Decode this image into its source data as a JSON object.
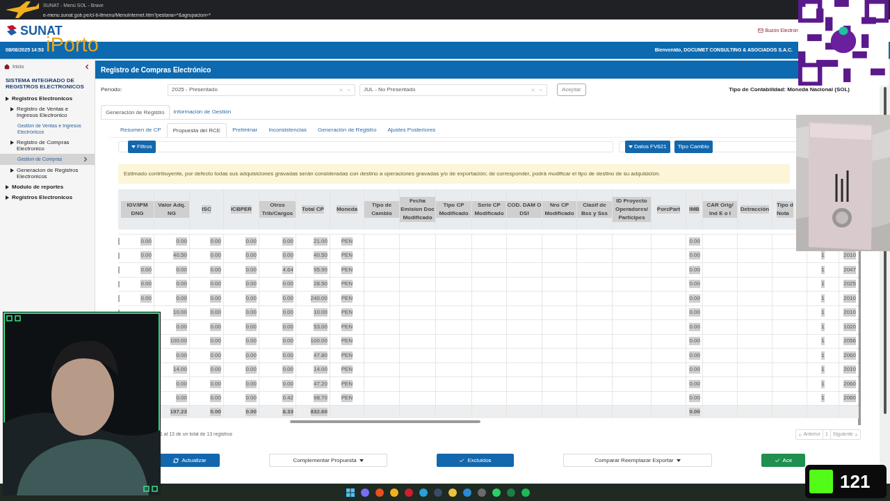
{
  "browser": {
    "title": "SUNAT - Menú SOL - Brave",
    "url": "e-menu.sunat.gob.pe/cl-ti-itmenu/MenuInternet.htm?pestana=*&agrupacion=*"
  },
  "header": {
    "logo": "SUNAT",
    "mailbox": "Buzón Electrón",
    "datetime": "08/08/2025 14:53",
    "welcome": "Bienvenido, DOCUMET CONSULTING & ASOCIADOS S.A.C."
  },
  "sidebar": {
    "home": "Inicio",
    "title": "SISTEMA INTEGRADO DE REGISTROS ELECTRONICOS",
    "items": [
      {
        "label": "Registros Electronicos",
        "kind": "folder",
        "selected": false,
        "children": [
          {
            "label": "Registro de Ventas e Ingresos Electronico",
            "kind": "folder",
            "selected": false,
            "children": [
              {
                "label": "Gestión de Ventas e Ingresos Electrónicos",
                "kind": "link",
                "selected": false
              }
            ]
          },
          {
            "label": "Registro de Compras Electronico",
            "kind": "folder",
            "selected": false,
            "children": [
              {
                "label": "Gestion de Compras",
                "kind": "link",
                "selected": true
              }
            ]
          },
          {
            "label": "Generacion de Registros Electronicos",
            "kind": "folder",
            "selected": false
          }
        ]
      },
      {
        "label": "Modulo de reportes",
        "kind": "folder",
        "selected": false
      },
      {
        "label": "Registros Electronicos",
        "kind": "folder",
        "selected": false
      }
    ]
  },
  "main": {
    "title": "Registro de Compras Electrónico",
    "period_label": "Período:",
    "year_select": "2025 - Presentado",
    "month_select": "JUL - No Presentado",
    "accept_button": "Aceptar",
    "accounting_type": "Tipo de Contabilidad: Moneda Nacional (SOL)",
    "tabs": [
      {
        "label": "Generación de Registro",
        "selected": true
      },
      {
        "label": "Información de Gestión",
        "selected": false
      }
    ],
    "subtabs": [
      {
        "label": "Resumen de CP",
        "selected": false
      },
      {
        "label": "Propuesta del RCE",
        "selected": true
      },
      {
        "label": "Preliminar",
        "selected": false
      },
      {
        "label": "Inconsistencias",
        "selected": false
      },
      {
        "label": "Generación de Registro",
        "selected": false
      },
      {
        "label": "Ajustes Posteriores",
        "selected": false
      }
    ],
    "filter_button": "Filtros",
    "fv621_button": "Datos FV621",
    "exchange_button": "Tipo Cambio",
    "notice": "Estimado contribuyente, por defecto todas sus adquisiciones gravadas serán consideradas con destino a operaciones gravadas y/o de exportación; de corresponder, podrá modificar el tipo de destino de su adquisición.",
    "table": {
      "columns": [
        "IGV/IPM DNG",
        "Valor Adq. NG",
        "ISC",
        "ICBPER",
        "Otros Trib/Cargos",
        "Total CP",
        "Moneda",
        "Tipo de Cambio",
        "Fecha Emision Doc Modificado",
        "Tipo CP Modificado",
        "Serie CP Modificado",
        "COD. DAM O DSI",
        "Nro CP Modificado",
        "Clasif de Bss y Sss",
        "ID Proyecto Operadores/ Participes",
        "PorcPart",
        "IMB",
        "CAR Orig/ Ind E o I",
        "Detracción",
        "Tipo d Nota"
      ],
      "rows": [
        {
          "igv": "0.00",
          "valor": "0.00",
          "isc": "0.00",
          "icbper": "0.00",
          "otros": "0.00",
          "total": "21.00",
          "moneda": "PEN",
          "imb": "0.00"
        },
        {
          "igv": "0.00",
          "valor": "40.50",
          "isc": "0.00",
          "icbper": "0.00",
          "otros": "0.00",
          "total": "40.50",
          "moneda": "PEN",
          "imb": "0.00",
          "column_21": "1",
          "column_22": "2010"
        },
        {
          "igv": "0.00",
          "valor": "0.00",
          "isc": "0.00",
          "icbper": "0.00",
          "otros": "4.64",
          "total": "95.90",
          "moneda": "PEN",
          "imb": "0.00",
          "column_21": "1",
          "column_22": "2047"
        },
        {
          "igv": "0.00",
          "valor": "0.00",
          "isc": "0.00",
          "icbper": "0.00",
          "otros": "0.00",
          "total": "28.50",
          "moneda": "PEN",
          "imb": "0.00",
          "column_21": "1",
          "column_22": "2025"
        },
        {
          "igv": "0.00",
          "valor": "0.00",
          "isc": "0.00",
          "icbper": "0.00",
          "otros": "0.00",
          "total": "240.00",
          "moneda": "PEN",
          "imb": "0.00",
          "column_21": "1",
          "column_22": "2010"
        },
        {
          "valor": "10.00",
          "isc": "0.00",
          "icbper": "0.00",
          "otros": "0.00",
          "total": "10.00",
          "moneda": "PEN",
          "imb": "0.00",
          "column_21": "1",
          "column_22": "2010"
        },
        {
          "valor": "0.00",
          "isc": "0.00",
          "icbper": "0.00",
          "otros": "0.00",
          "total": "53.00",
          "moneda": "PEN",
          "imb": "0.00",
          "column_21": "1",
          "column_22": "1020"
        },
        {
          "valor": "100.00",
          "isc": "0.00",
          "icbper": "0.00",
          "otros": "0.00",
          "total": "100.00",
          "moneda": "PEN",
          "imb": "0.00",
          "column_21": "1",
          "column_22": "2056"
        },
        {
          "valor": "0.00",
          "isc": "0.00",
          "icbper": "0.00",
          "otros": "0.00",
          "total": "47.80",
          "moneda": "PEN",
          "imb": "0.00",
          "column_21": "1",
          "column_22": "2060"
        },
        {
          "valor": "14.00",
          "isc": "0.00",
          "icbper": "0.00",
          "otros": "0.00",
          "total": "14.00",
          "moneda": "PEN",
          "imb": "0.00",
          "column_21": "1",
          "column_22": "2010"
        },
        {
          "valor": "0.00",
          "isc": "0.00",
          "icbper": "0.00",
          "otros": "0.00",
          "total": "47.20",
          "moneda": "PEN",
          "imb": "0.00",
          "column_21": "1",
          "column_22": "2060"
        },
        {
          "valor": "0.00",
          "isc": "0.00",
          "icbper": "0.00",
          "otros": "0.42",
          "total": "98.70",
          "moneda": "PEN",
          "imb": "0.00",
          "column_21": "1",
          "column_22": "2060"
        }
      ],
      "totals": {
        "valor": "197.23",
        "isc": "0.00",
        "icbper": "0.00",
        "otros": "8.33",
        "total": "832.60",
        "imb": "0.00"
      }
    },
    "records_info": "1 al 13 de un total de 13 registros",
    "pagination": {
      "previous": "Anterior",
      "page": "1",
      "next": "Siguiente"
    },
    "actions": [
      {
        "label": "Actualizar",
        "kind": "refresh"
      },
      {
        "label": "Complementar Propuesta",
        "kind": "dropdown"
      },
      {
        "label": "Excluidos",
        "kind": "check"
      },
      {
        "label": "Comparar Reemplazar Exportar",
        "kind": "dropdown"
      },
      {
        "label": "Ace",
        "kind": "accept"
      }
    ]
  },
  "overlays": {
    "brand": "iPorto",
    "counter": "121"
  }
}
